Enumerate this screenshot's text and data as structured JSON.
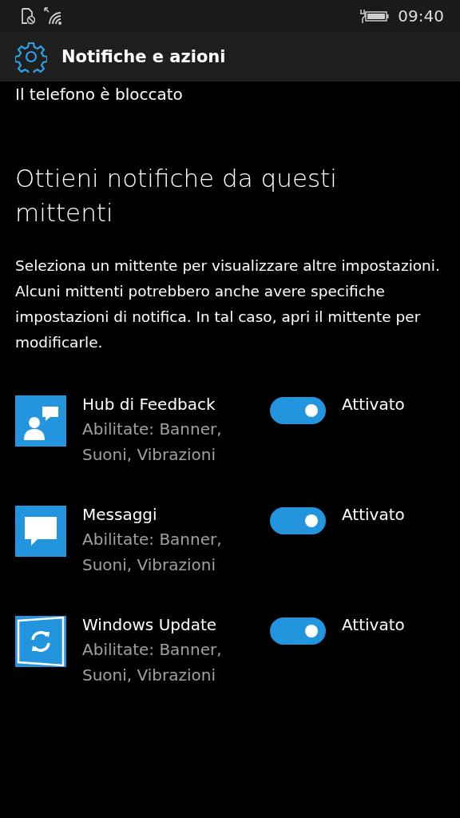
{
  "status_bar": {
    "time": "09:40"
  },
  "header": {
    "title": "Notifiche e azioni"
  },
  "previous_text": "Il telefono è bloccato",
  "section": {
    "title": "Ottieni notifiche da questi mittenti",
    "description": "Seleziona un mittente per visualizzare altre impostazioni. Alcuni mittenti potrebbero anche avere specifiche impostazioni di notifica. In tal caso, apri il mittente per modificarle."
  },
  "senders": [
    {
      "kind": "feedback",
      "name": "Hub di Feedback",
      "detail": "Abilitate: Banner, Suoni, Vibrazioni",
      "on": true,
      "state_label": "Attivato"
    },
    {
      "kind": "messages",
      "name": "Messaggi",
      "detail": "Abilitate: Banner, Suoni, Vibrazioni",
      "on": true,
      "state_label": "Attivato"
    },
    {
      "kind": "update",
      "name": "Windows Update",
      "detail": "Abilitate: Banner, Suoni, Vibrazioni",
      "on": true,
      "state_label": "Attivato"
    }
  ]
}
